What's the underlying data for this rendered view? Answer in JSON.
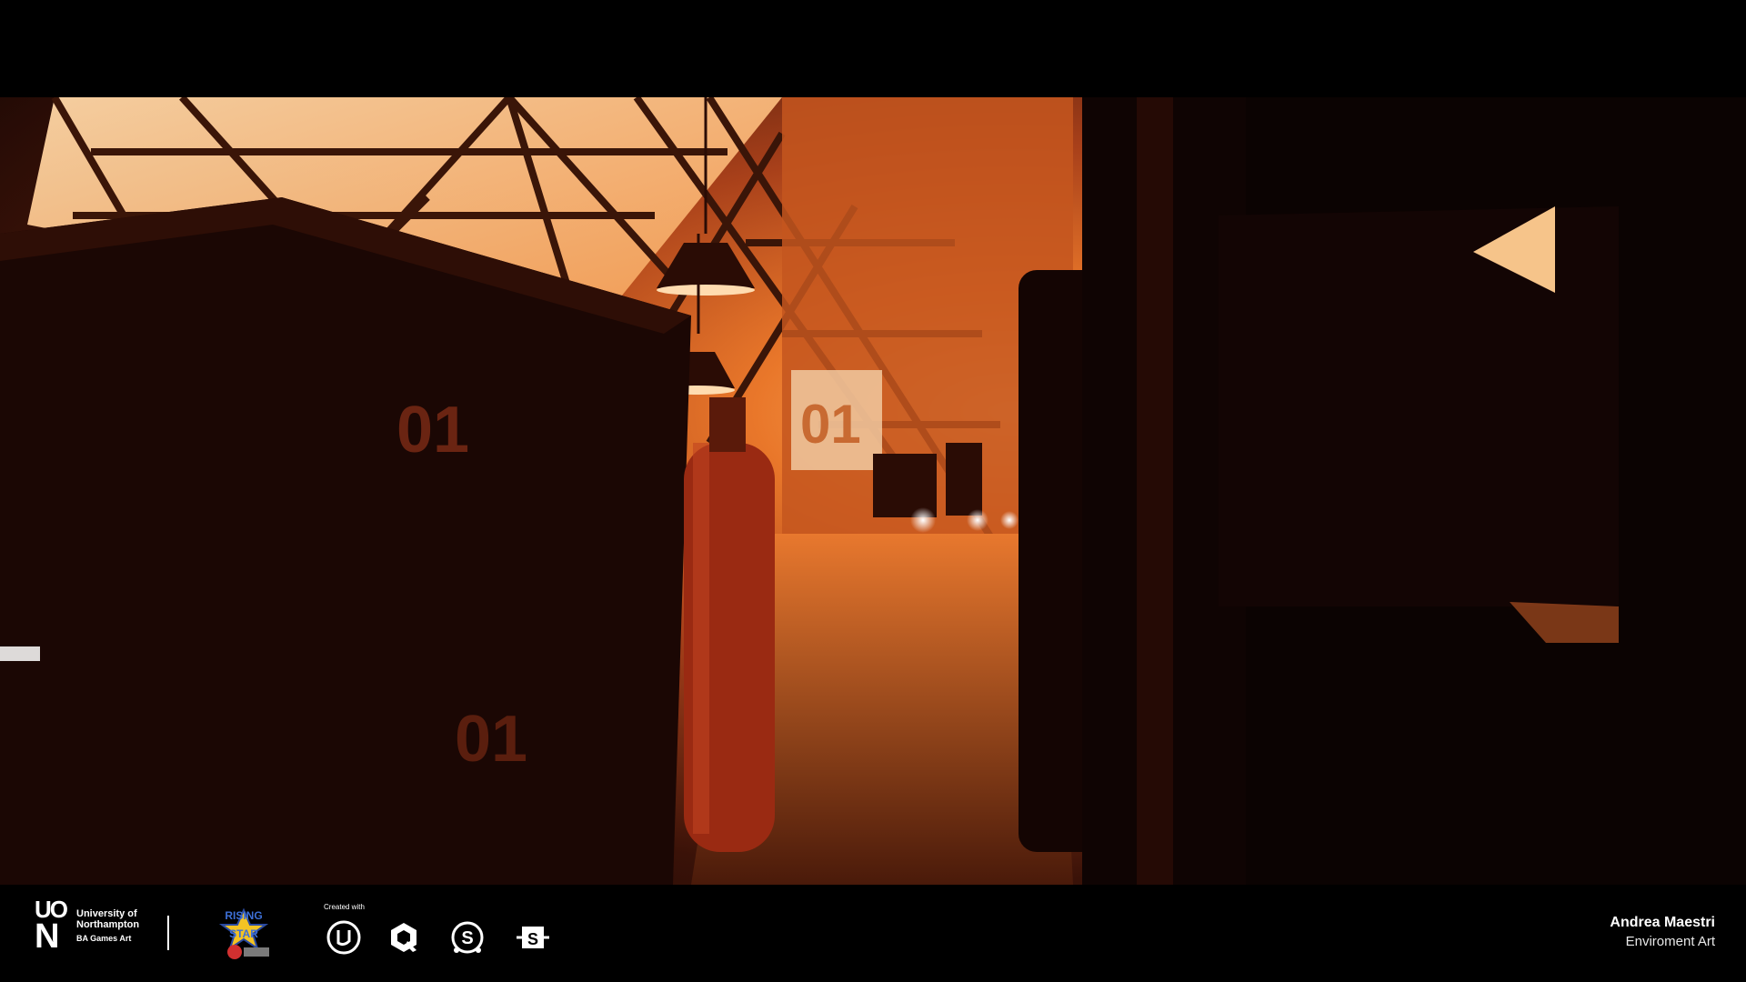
{
  "footer": {
    "uon": {
      "mark_top": "UO",
      "mark_bottom": "N",
      "institution": "University of Northampton",
      "course": "BA Games Art"
    },
    "rising_star": {
      "logo_text_top": "RISING",
      "logo_text_bottom": "STAR"
    },
    "created_with_label": "Created with",
    "tools": [
      {
        "name": "unreal-engine-icon"
      },
      {
        "name": "quixel-icon"
      },
      {
        "name": "substance-painter-icon"
      },
      {
        "name": "substance-designer-icon"
      }
    ],
    "author": {
      "name": "Andrea Maestri",
      "role": "Enviroment Art"
    }
  },
  "scene": {
    "container_label_left_upper": "01",
    "container_label_left_lower": "01",
    "wall_label": "01",
    "palette": {
      "glow": "#ffb060",
      "orange": "#e9772a",
      "shadow": "#1a0603"
    }
  }
}
